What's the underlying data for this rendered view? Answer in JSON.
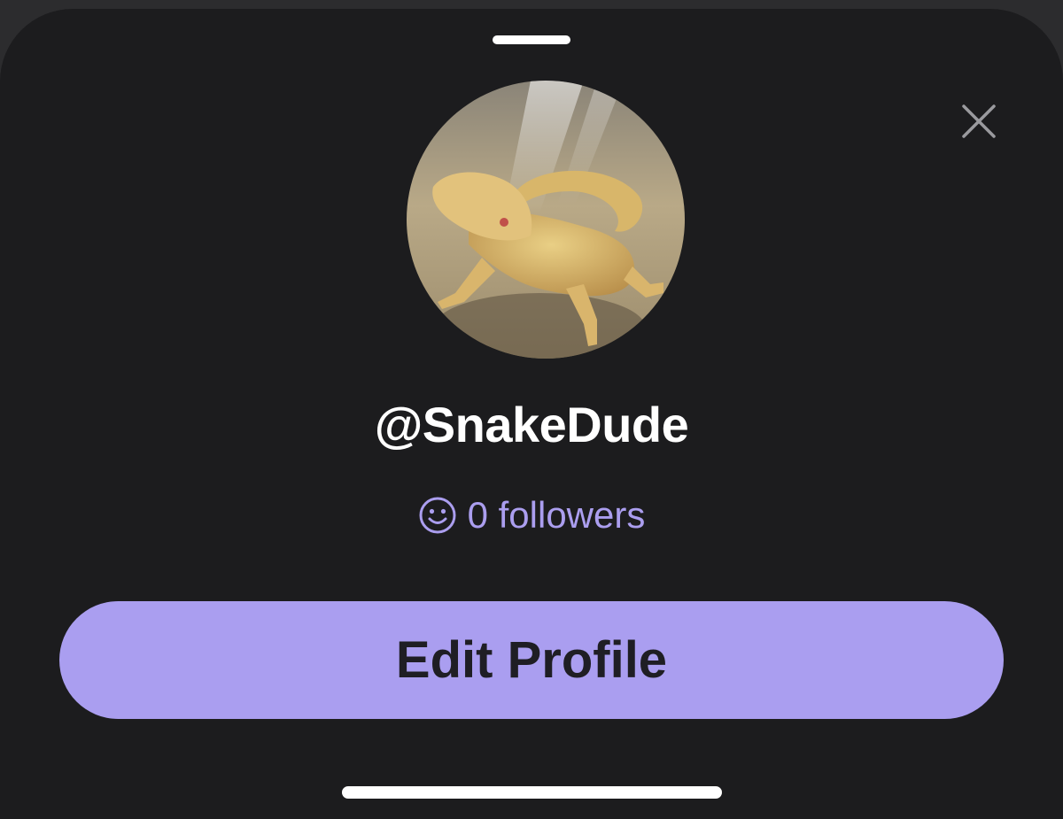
{
  "profile": {
    "username": "@SnakeDude",
    "followers_text": "0 followers",
    "followers_count": 0,
    "avatar_icon": "bearded-dragon-photo"
  },
  "actions": {
    "edit_profile_label": "Edit Profile",
    "close_icon": "close-icon"
  },
  "colors": {
    "sheet_background": "#1c1c1e",
    "accent": "#aa9ef0",
    "followers_text": "#ab9eef",
    "button_text": "#1f1e24"
  }
}
